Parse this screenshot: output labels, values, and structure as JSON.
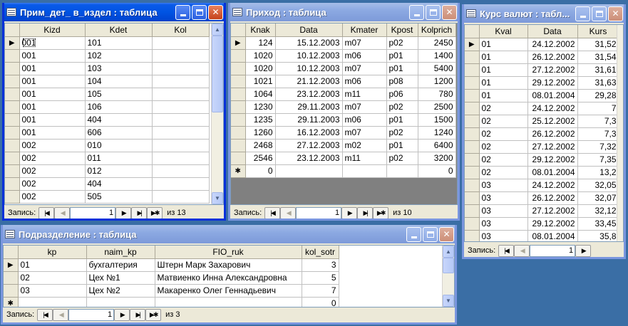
{
  "windows": {
    "prim": {
      "title": "Прим_дет_ в_издел : таблица",
      "columns": [
        "Kizd",
        "Kdet",
        "Kol"
      ],
      "rows": [
        [
          "001",
          "101",
          ""
        ],
        [
          "001",
          "102",
          ""
        ],
        [
          "001",
          "103",
          ""
        ],
        [
          "001",
          "104",
          ""
        ],
        [
          "001",
          "105",
          ""
        ],
        [
          "001",
          "106",
          ""
        ],
        [
          "001",
          "404",
          ""
        ],
        [
          "001",
          "606",
          ""
        ],
        [
          "002",
          "010",
          ""
        ],
        [
          "002",
          "011",
          ""
        ],
        [
          "002",
          "012",
          ""
        ],
        [
          "002",
          "404",
          ""
        ],
        [
          "002",
          "505",
          ""
        ]
      ],
      "nav": {
        "label": "Запись:",
        "current": "1",
        "total": "из 13"
      }
    },
    "prihod": {
      "title": "Приход : таблица",
      "columns": [
        "Knak",
        "Data",
        "Kmater",
        "Kpost",
        "Kolprich"
      ],
      "rows": [
        [
          "124",
          "15.12.2003",
          "m07",
          "p02",
          "2450"
        ],
        [
          "1020",
          "10.12.2003",
          "m06",
          "p01",
          "1400"
        ],
        [
          "1020",
          "10.12.2003",
          "m07",
          "p01",
          "5400"
        ],
        [
          "1021",
          "21.12.2003",
          "m06",
          "p08",
          "1200"
        ],
        [
          "1064",
          "23.12.2003",
          "m11",
          "p06",
          "780"
        ],
        [
          "1230",
          "29.11.2003",
          "m07",
          "p02",
          "2500"
        ],
        [
          "1235",
          "29.11.2003",
          "m06",
          "p01",
          "1500"
        ],
        [
          "1260",
          "16.12.2003",
          "m07",
          "p02",
          "1240"
        ],
        [
          "2468",
          "27.12.2003",
          "m02",
          "p01",
          "6400"
        ],
        [
          "2546",
          "23.12.2003",
          "m11",
          "p02",
          "3200"
        ]
      ],
      "newrow": [
        "0",
        "",
        "",
        "",
        "0"
      ],
      "nav": {
        "label": "Запись:",
        "current": "1",
        "total": "из 10"
      }
    },
    "kurs": {
      "title": "Курс валют : табл...",
      "columns": [
        "Kval",
        "Data",
        "Kurs"
      ],
      "rows": [
        [
          "01",
          "24.12.2002",
          "31,52"
        ],
        [
          "01",
          "26.12.2002",
          "31,54"
        ],
        [
          "01",
          "27.12.2002",
          "31,61"
        ],
        [
          "01",
          "29.12.2002",
          "31,63"
        ],
        [
          "01",
          "08.01.2004",
          "29,28"
        ],
        [
          "02",
          "24.12.2002",
          "7"
        ],
        [
          "02",
          "25.12.2002",
          "7,3"
        ],
        [
          "02",
          "26.12.2002",
          "7,3"
        ],
        [
          "02",
          "27.12.2002",
          "7,32"
        ],
        [
          "02",
          "29.12.2002",
          "7,35"
        ],
        [
          "02",
          "08.01.2004",
          "13,2"
        ],
        [
          "03",
          "24.12.2002",
          "32,05"
        ],
        [
          "03",
          "26.12.2002",
          "32,07"
        ],
        [
          "03",
          "27.12.2002",
          "32,12"
        ],
        [
          "03",
          "29.12.2002",
          "33,45"
        ],
        [
          "03",
          "08.01.2004",
          "35,8"
        ]
      ],
      "nav": {
        "label": "Запись:",
        "current": "1"
      }
    },
    "podr": {
      "title": "Подразделение : таблица",
      "columns": [
        "kp",
        "naim_kp",
        "FIO_ruk",
        "kol_sotr"
      ],
      "rows": [
        [
          "01",
          "бухгалтерия",
          "Штерн Марк Захарович",
          "3"
        ],
        [
          "02",
          "Цех №1",
          "Матвиенко Инна Александровна",
          "5"
        ],
        [
          "03",
          "Цех №2",
          "Макаренко Олег Геннадьевич",
          "7"
        ]
      ],
      "newrow": [
        "",
        "",
        "",
        "0"
      ],
      "nav": {
        "label": "Запись:",
        "current": "1",
        "total": "из 3"
      }
    }
  },
  "icons": {
    "record_pointer": "▶",
    "new_record": "✱",
    "first": "|◀",
    "prev": "◀",
    "next": "▶",
    "last": "▶|",
    "new": "▶✱"
  }
}
